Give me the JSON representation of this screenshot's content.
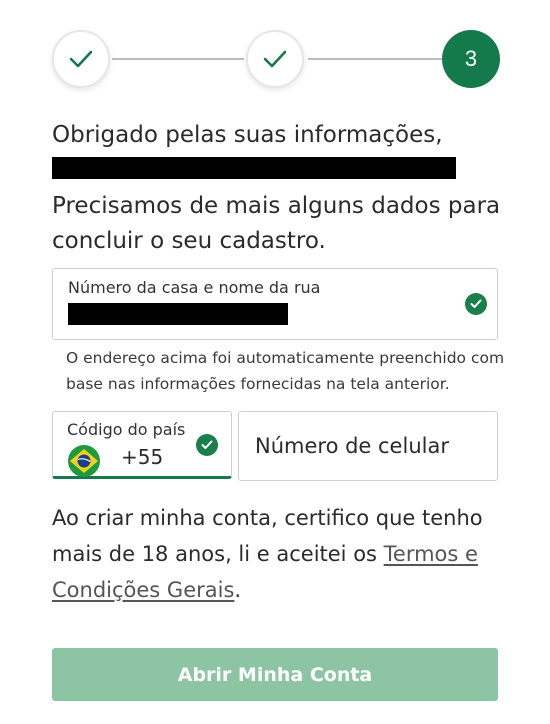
{
  "stepper": {
    "steps": [
      {
        "state": "completed",
        "icon": "check-icon"
      },
      {
        "state": "completed",
        "icon": "check-icon"
      },
      {
        "state": "current",
        "label": "3"
      }
    ],
    "current_step": 3
  },
  "intro": {
    "greeting": "Obrigado pelas suas informações,",
    "message": "Precisamos de mais alguns dados para concluir o seu cadastro."
  },
  "address": {
    "label": "Número da casa e nome da rua",
    "value_redacted": true,
    "valid": true,
    "helper": "O endereço acima foi automaticamente preenchido com base nas informações fornecidas na tela anterior."
  },
  "country": {
    "label": "Código do país",
    "code": "+55",
    "flag": "brazil-flag-icon",
    "valid": true
  },
  "phone": {
    "placeholder": "Número de celular",
    "value": ""
  },
  "terms": {
    "text_before": "Ao criar minha conta, certifico que tenho mais de 18 anos, li e aceitei os ",
    "link": "Termos e Condições Gerais",
    "text_after": "."
  },
  "submit": {
    "label": "Abrir Minha Conta",
    "enabled": false
  },
  "colors": {
    "primary": "#157a4b",
    "button_disabled": "#8cc4a4",
    "border": "#cfcfcf",
    "text": "#2b2b2b"
  }
}
